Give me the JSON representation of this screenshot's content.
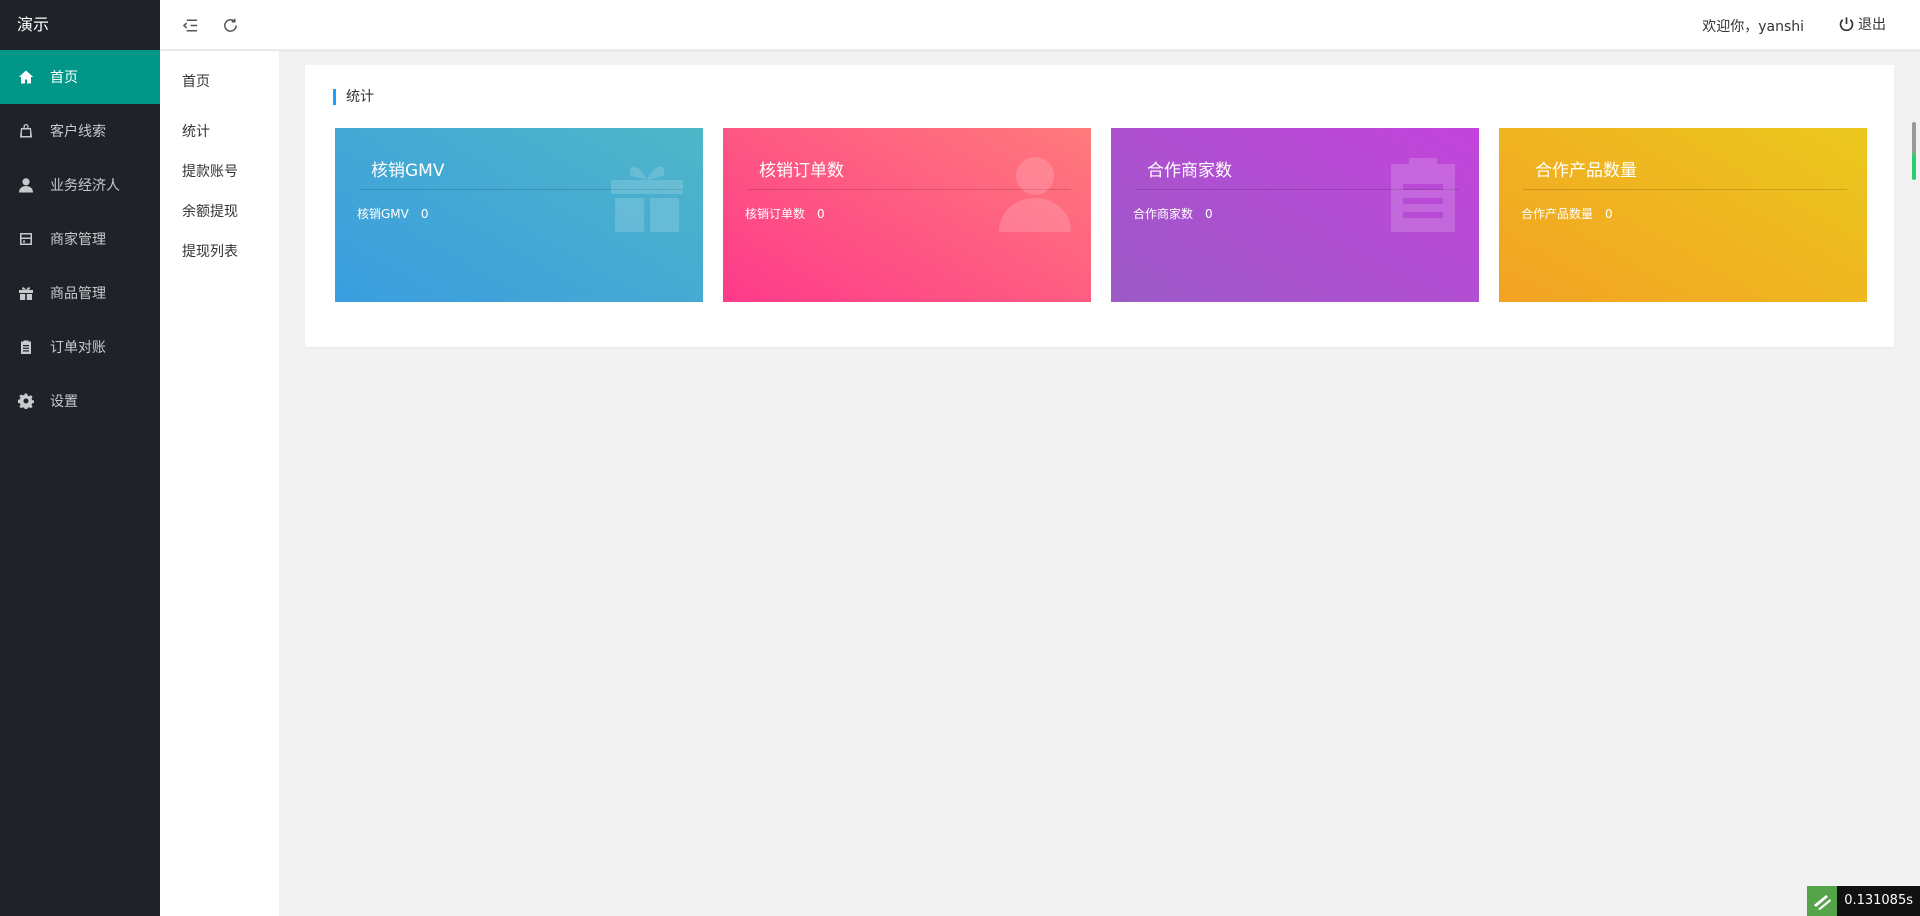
{
  "app": {
    "logo": "演示"
  },
  "sidebar": {
    "items": [
      {
        "label": "首页",
        "icon": "home-icon",
        "active": true
      },
      {
        "label": "客户线索",
        "icon": "bag-icon"
      },
      {
        "label": "业务经济人",
        "icon": "user-icon"
      },
      {
        "label": "商家管理",
        "icon": "store-icon"
      },
      {
        "label": "商品管理",
        "icon": "gift-icon"
      },
      {
        "label": "订单对账",
        "icon": "clipboard-icon"
      },
      {
        "label": "设置",
        "icon": "gear-icon"
      }
    ]
  },
  "header": {
    "welcome": "欢迎你，yanshi",
    "logout_label": "退出"
  },
  "subnav": {
    "title": "首页",
    "items": [
      "统计",
      "提款账号",
      "余额提现",
      "提现列表"
    ]
  },
  "main": {
    "section_title": "统计",
    "stats": [
      {
        "title": "核销GMV",
        "label": "核销GMV",
        "value": "0",
        "icon": "gift-icon",
        "gradient": [
          "#3a9de0",
          "#4fb6c7"
        ]
      },
      {
        "title": "核销订单数",
        "label": "核销订单数",
        "value": "0",
        "icon": "user-icon",
        "gradient": [
          "#fe3a8a",
          "#ff7b7b"
        ]
      },
      {
        "title": "合作商家数",
        "label": "合作商家数",
        "value": "0",
        "icon": "clipboard-icon",
        "gradient": [
          "#9b5ac6",
          "#c444dc"
        ]
      },
      {
        "title": "合作产品数量",
        "label": "合作产品数量",
        "value": "0",
        "icon": "none",
        "gradient": [
          "#f3a224",
          "#ebc81d"
        ]
      }
    ]
  },
  "perf_badge": {
    "time": "0.131085s"
  }
}
